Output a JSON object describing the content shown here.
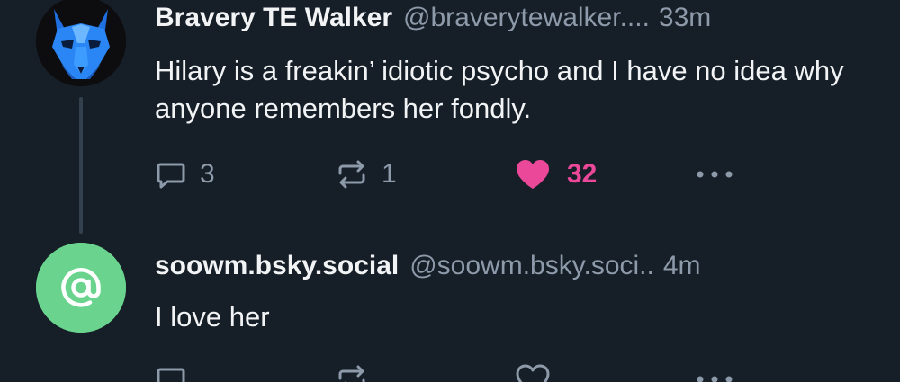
{
  "colors": {
    "background": "#161e27",
    "text_primary": "#f1f3f5",
    "text_secondary": "#8d9aaa",
    "like_active": "#ec4899",
    "thread_line": "#33414f",
    "default_avatar": "#6ad48e"
  },
  "posts": [
    {
      "display_name": "Bravery TE Walker",
      "handle": "@braverytewalker....",
      "timestamp": "33m",
      "text": "Hilary is a freakin’ idiotic psycho and I have no idea why anyone remembers her fondly.",
      "avatar_icon": "blue-wolf-mask-avatar",
      "reply_count": "3",
      "repost_count": "1",
      "like_count": "32",
      "liked": true
    },
    {
      "display_name": "soowm.bsky.social",
      "handle": "@soowm.bsky.soci..",
      "timestamp": "4m",
      "text": "I love her",
      "avatar_icon": "at-sign-default-avatar",
      "reply_count": "",
      "repost_count": "",
      "like_count": "",
      "liked": false
    }
  ]
}
